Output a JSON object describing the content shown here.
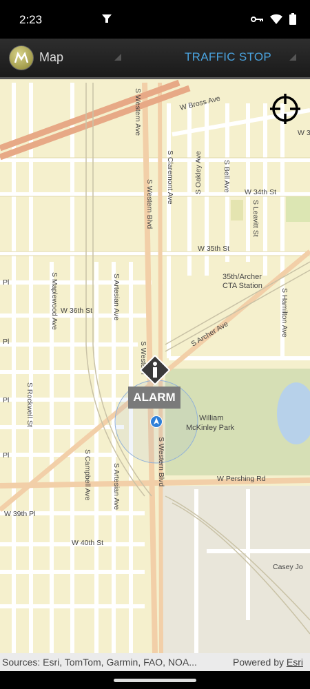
{
  "status_bar": {
    "time": "2:23",
    "icons": [
      "notification-fork-icon",
      "vpn-key-icon",
      "wifi-icon",
      "battery-icon"
    ]
  },
  "app_bar": {
    "title": "Map",
    "status": "TRAFFIC STOP",
    "status_color": "#4aa3df"
  },
  "map": {
    "streets": {
      "w_bross_ave": "W Bross Ave",
      "s_western_ave": "S Western Ave",
      "s_western_blvd_top": "S Western Blvd",
      "s_claremont_ave": "S Claremont Ave",
      "s_bell_ave": "S Bell Ave",
      "w_34th_st": "W 34th St",
      "s_oakley_ave": "S Oakley Ave",
      "s_leavitt_st": "S Leavitt St",
      "w_35th_st": "W 35th St",
      "s_maplewood_ave": "S Maplewood Ave",
      "s_artesian_ave_top": "S Artesian Ave",
      "w_36th_st": "W 36th St",
      "s_archer_ave": "S Archer Ave",
      "s_hamilton_ave": "S Hamilton Ave",
      "s_western_mid": "S Western",
      "s_rockwell_st": "S Rockwell St",
      "s_western_blvd_bottom": "S Western Blvd",
      "s_campbell_ave": "S Campbell Ave",
      "s_artesian_ave_bottom": "S Artesian Ave",
      "w_pershing_rd": "W Pershing Rd",
      "w_39th_pl": "W 39th Pl",
      "w_40th_st": "W 40th St",
      "casey_jo": "Casey Jo",
      "w_3": "W 3",
      "pl_1": "Pl",
      "pl_2": "Pl",
      "pl_3": "Pl",
      "pl_4": "Pl"
    },
    "places": {
      "cta_line1": "35th/Archer",
      "cta_line2": "CTA Station",
      "park_line1": "William",
      "park_line2": "McKinley Park"
    },
    "incident": {
      "label": "ALARM",
      "icon": "info-icon"
    }
  },
  "attribution": {
    "sources": "Sources: Esri, TomTom, Garmin, FAO, NOA...",
    "powered_by": "Powered by ",
    "esri": "Esri"
  }
}
